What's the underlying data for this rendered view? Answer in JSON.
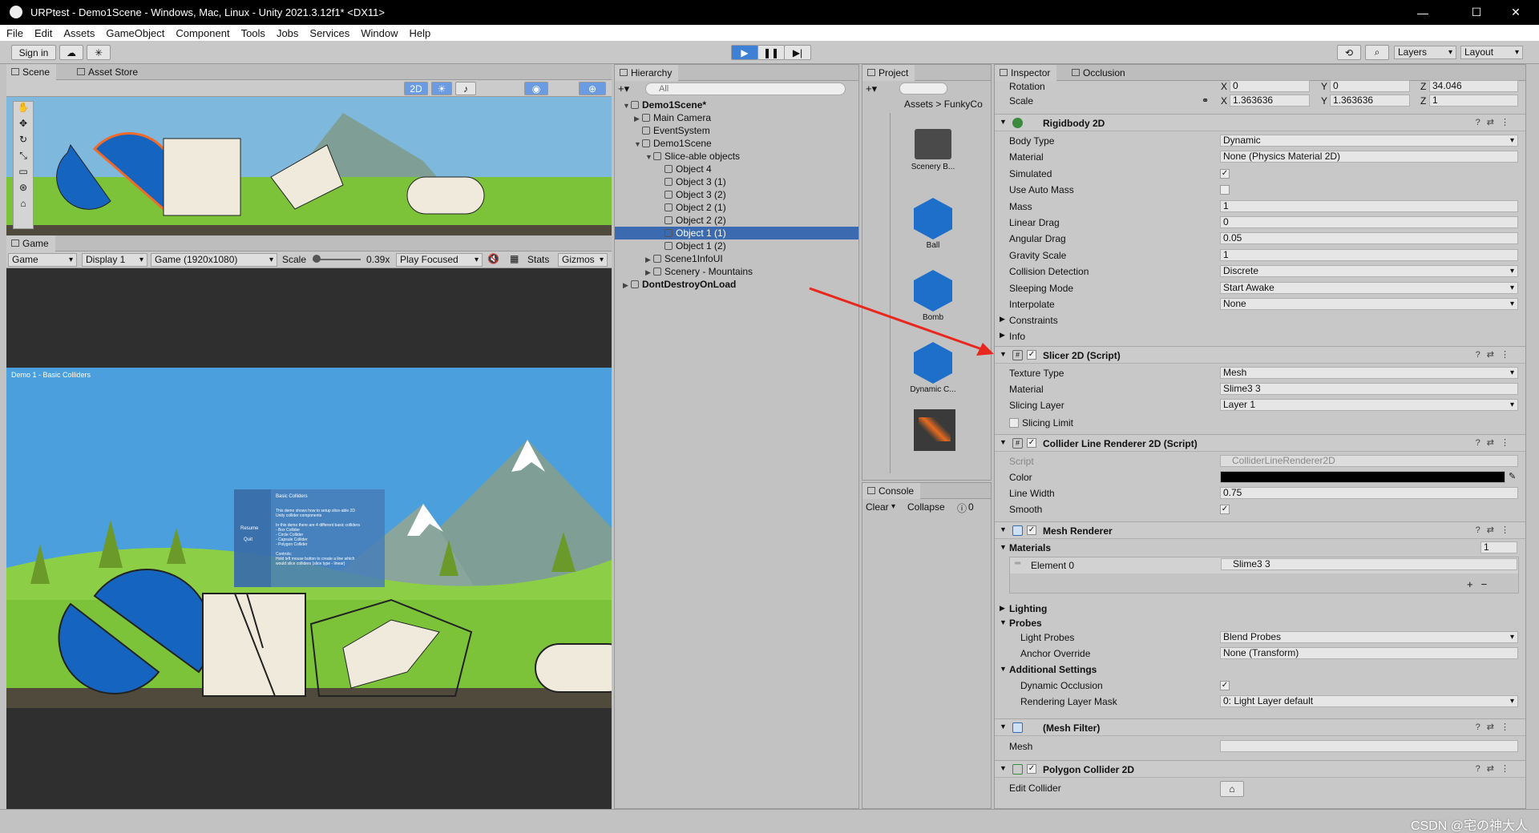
{
  "window": {
    "title": "URPtest - Demo1Scene - Windows, Mac, Linux - Unity 2021.3.12f1* <DX11>",
    "minimize": "—",
    "maximize": "☐",
    "close": "✕"
  },
  "menu": [
    "File",
    "Edit",
    "Assets",
    "GameObject",
    "Component",
    "Tools",
    "Jobs",
    "Services",
    "Window",
    "Help"
  ],
  "toolbar": {
    "sign_in": "Sign in",
    "layers": "Layers",
    "layout": "Layout"
  },
  "scene": {
    "tab_scene": "Scene",
    "tab_asset_store": "Asset Store",
    "mode_2d": "2D"
  },
  "game": {
    "tab": "Game",
    "view": "Game",
    "display": "Display 1",
    "resolution": "Game (1920x1080)",
    "scale_label": "Scale",
    "scale_value": "0.39x",
    "play_focused": "Play Focused",
    "stats": "Stats",
    "gizmos": "Gizmos",
    "overlay_label": "Demo 1 - Basic Colliders",
    "panel": {
      "title": "Basic Colliders",
      "resume": "Resume",
      "quit": "Quit",
      "lines": [
        "This demo shows how to setup slice-able 2D",
        "Unity collider components",
        "",
        "In this demo there are 4 different basic colliders",
        "- Box Collider",
        "- Circle Collider",
        "- Capsule Collider",
        "- Polygon Collider",
        "",
        "Controls:",
        "Hold left mouse button to create a line which",
        "would slice colliders (slice type - linear)"
      ]
    }
  },
  "hierarchy": {
    "tab": "Hierarchy",
    "search": "All",
    "rows": [
      {
        "label": "Demo1Scene*",
        "level": 0,
        "arrow": "▼",
        "icon": "scene",
        "selected": false
      },
      {
        "label": "Main Camera",
        "level": 1,
        "arrow": "▶",
        "icon": "cube",
        "selected": false
      },
      {
        "label": "EventSystem",
        "level": 1,
        "arrow": "",
        "icon": "cube",
        "selected": false
      },
      {
        "label": "Demo1Scene",
        "level": 1,
        "arrow": "▼",
        "icon": "cube",
        "selected": false
      },
      {
        "label": "Slice-able objects",
        "level": 2,
        "arrow": "▼",
        "icon": "cube",
        "selected": false
      },
      {
        "label": "Object 4",
        "level": 3,
        "arrow": "",
        "icon": "cube",
        "selected": false
      },
      {
        "label": "Object 3 (1)",
        "level": 3,
        "arrow": "",
        "icon": "cube",
        "selected": false
      },
      {
        "label": "Object 3 (2)",
        "level": 3,
        "arrow": "",
        "icon": "cube",
        "selected": false
      },
      {
        "label": "Object 2 (1)",
        "level": 3,
        "arrow": "",
        "icon": "cube",
        "selected": false
      },
      {
        "label": "Object 2 (2)",
        "level": 3,
        "arrow": "",
        "icon": "cube",
        "selected": false
      },
      {
        "label": "Object 1 (1)",
        "level": 3,
        "arrow": "",
        "icon": "cube",
        "selected": true
      },
      {
        "label": "Object 1 (2)",
        "level": 3,
        "arrow": "",
        "icon": "cube",
        "selected": false
      },
      {
        "label": "Scene1InfoUI",
        "level": 2,
        "arrow": "▶",
        "icon": "cube",
        "selected": false
      },
      {
        "label": "Scenery - Mountains",
        "level": 2,
        "arrow": "▶",
        "icon": "cube",
        "selected": false
      },
      {
        "label": "DontDestroyOnLoad",
        "level": 0,
        "arrow": "▶",
        "icon": "scene",
        "selected": false
      }
    ]
  },
  "project": {
    "tab": "Project",
    "breadcrumb_root": "Assets",
    "breadcrumb_sep": ">",
    "breadcrumb_current": "FunkyCo",
    "items": [
      {
        "label": "Scenery B...",
        "icon": "folder"
      },
      {
        "label": "Ball",
        "icon": "cube"
      },
      {
        "label": "Bomb",
        "icon": "cube"
      },
      {
        "label": "Dynamic C...",
        "icon": "cube"
      }
    ]
  },
  "console": {
    "tab": "Console",
    "clear": "Clear",
    "collapse": "Collapse",
    "count": "0"
  },
  "inspector": {
    "tab": "Inspector",
    "tab2": "Occlusion",
    "rotation": {
      "label": "Rotation",
      "x": "0",
      "y": "0",
      "z": "34.046"
    },
    "scale": {
      "label": "Scale",
      "x": "1.363636",
      "y": "1.363636",
      "z": "1"
    },
    "rigidbody": {
      "name": "Rigidbody 2D",
      "rows": [
        {
          "label": "Body Type",
          "value": "Dynamic",
          "kind": "dropdown"
        },
        {
          "label": "Material",
          "value": "None (Physics Material 2D)",
          "kind": "object"
        },
        {
          "label": "Simulated",
          "value": "✓",
          "kind": "check"
        },
        {
          "label": "Use Auto Mass",
          "value": "",
          "kind": "check"
        },
        {
          "label": "Mass",
          "value": "1",
          "kind": "field"
        },
        {
          "label": "Linear Drag",
          "value": "0",
          "kind": "field"
        },
        {
          "label": "Angular Drag",
          "value": "0.05",
          "kind": "field"
        },
        {
          "label": "Gravity Scale",
          "value": "1",
          "kind": "field"
        },
        {
          "label": "Collision Detection",
          "value": "Discrete",
          "kind": "dropdown"
        },
        {
          "label": "Sleeping Mode",
          "value": "Start Awake",
          "kind": "dropdown"
        },
        {
          "label": "Interpolate",
          "value": "None",
          "kind": "dropdown"
        }
      ],
      "constraints": "Constraints",
      "info": "Info"
    },
    "slicer": {
      "name": "Slicer 2D (Script)",
      "rows": [
        {
          "label": "Texture Type",
          "value": "Mesh",
          "kind": "dropdown"
        },
        {
          "label": "Material",
          "value": "Slime3 3",
          "kind": "object"
        },
        {
          "label": "Slicing Layer",
          "value": "Layer 1",
          "kind": "dropdown"
        }
      ],
      "slicing_limit": "Slicing Limit"
    },
    "collider_line": {
      "name": "Collider Line Renderer 2D (Script)",
      "script_label": "Script",
      "script_value": "ColliderLineRenderer2D",
      "color_label": "Color",
      "color_value": "#000000",
      "line_width_label": "Line Width",
      "line_width_value": "0.75",
      "smooth_label": "Smooth",
      "smooth_value": "✓"
    },
    "mesh_renderer": {
      "name": "Mesh Renderer",
      "materials": "Materials",
      "materials_count": "1",
      "element0_label": "Element 0",
      "element0_value": "Slime3 3",
      "add": "+",
      "remove": "−",
      "lighting": "Lighting",
      "probes": "Probes",
      "light_probes_label": "Light Probes",
      "light_probes_value": "Blend Probes",
      "anchor_label": "Anchor Override",
      "anchor_value": "None (Transform)",
      "additional": "Additional Settings",
      "dyn_occ_label": "Dynamic Occlusion",
      "dyn_occ_value": "✓",
      "rlm_label": "Rendering Layer Mask",
      "rlm_value": "0: Light Layer default"
    },
    "mesh_filter": {
      "name": "(Mesh Filter)",
      "mesh_label": "Mesh"
    },
    "polygon": {
      "name": "Polygon Collider 2D",
      "edit_label": "Edit Collider"
    }
  },
  "watermark": "CSDN @宅の神大人",
  "colors": {
    "sky": "#4a9fdc",
    "grass": "#7cc33a",
    "mountain": "#7f9f96",
    "blue_shape": "#1565c0",
    "cream": "#efeadc",
    "selection": "#3b6ab0",
    "annotation_arrow": "#e8281e"
  }
}
